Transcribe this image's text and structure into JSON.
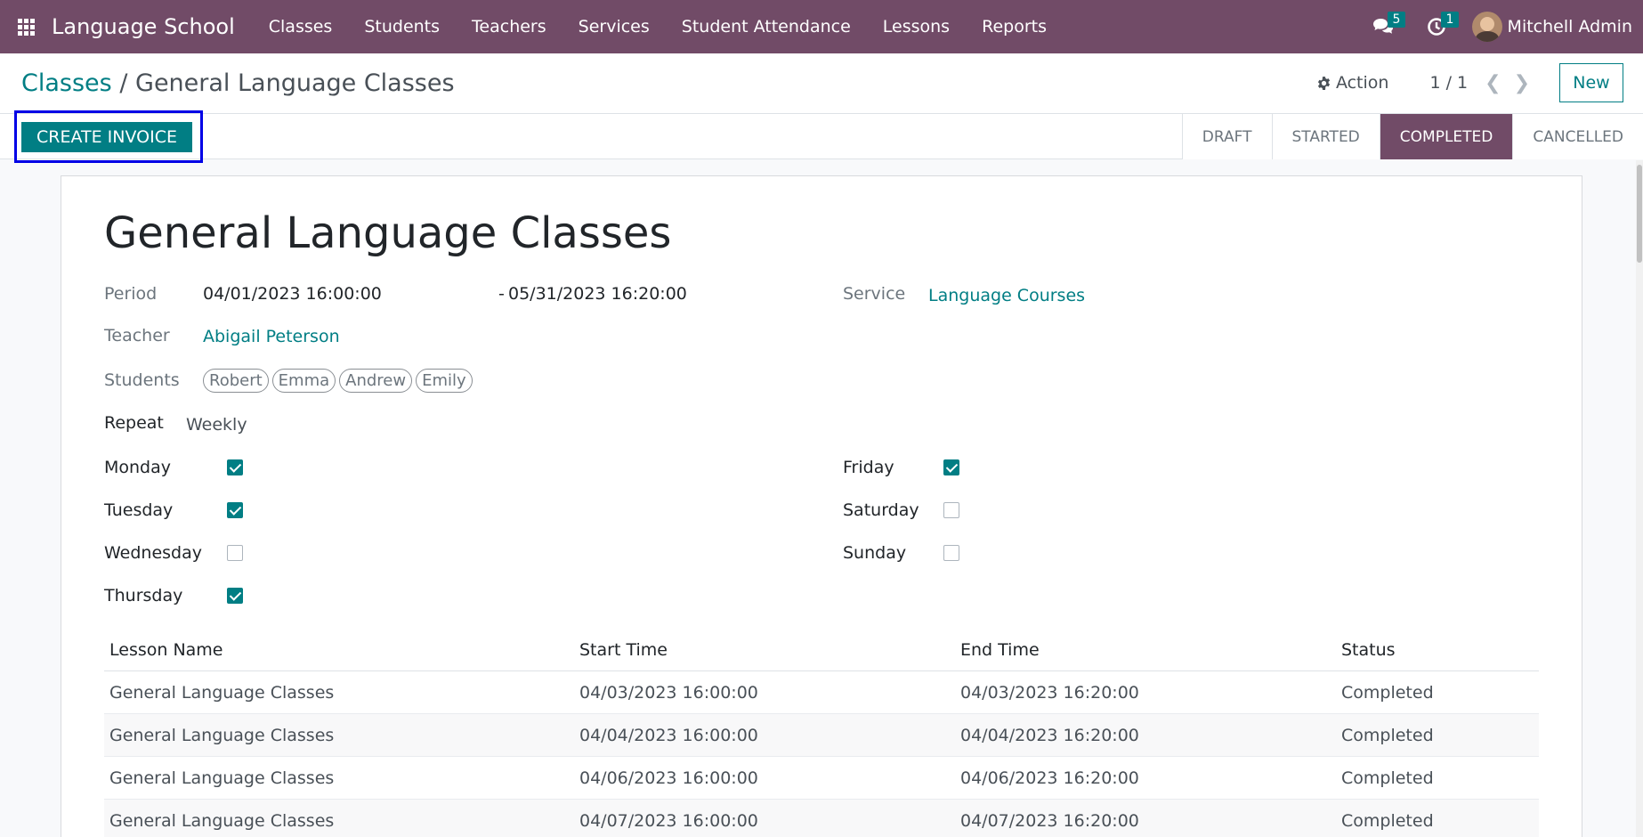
{
  "navbar": {
    "brand": "Language School",
    "menu": [
      "Classes",
      "Students",
      "Teachers",
      "Services",
      "Student Attendance",
      "Lessons",
      "Reports"
    ],
    "messages_count": "5",
    "activities_count": "1",
    "user_name": "Mitchell Admin"
  },
  "control_panel": {
    "breadcrumb_parent": "Classes",
    "breadcrumb_sep": "/",
    "breadcrumb_current": "General Language Classes",
    "action_label": "Action",
    "pager": "1 / 1",
    "new_label": "New"
  },
  "statusbar": {
    "create_invoice_label": "CREATE INVOICE",
    "stages": [
      "DRAFT",
      "STARTED",
      "COMPLETED",
      "CANCELLED"
    ],
    "active_stage": "COMPLETED"
  },
  "form": {
    "title": "General Language Classes",
    "period_label": "Period",
    "period_start": "04/01/2023 16:00:00",
    "period_end": "05/31/2023 16:20:00",
    "period_dash": "-",
    "service_label": "Service",
    "service_value": "Language Courses",
    "teacher_label": "Teacher",
    "teacher_value": "Abigail Peterson",
    "students_label": "Students",
    "students": [
      "Robert",
      "Emma",
      "Andrew",
      "Emily"
    ],
    "repeat_label": "Repeat",
    "repeat_value": "Weekly",
    "days": {
      "monday": {
        "label": "Monday",
        "checked": true
      },
      "tuesday": {
        "label": "Tuesday",
        "checked": true
      },
      "wednesday": {
        "label": "Wednesday",
        "checked": false
      },
      "thursday": {
        "label": "Thursday",
        "checked": true
      },
      "friday": {
        "label": "Friday",
        "checked": true
      },
      "saturday": {
        "label": "Saturday",
        "checked": false
      },
      "sunday": {
        "label": "Sunday",
        "checked": false
      }
    }
  },
  "lessons": {
    "columns": [
      "Lesson Name",
      "Start Time",
      "End Time",
      "Status"
    ],
    "rows": [
      [
        "General Language Classes",
        "04/03/2023 16:00:00",
        "04/03/2023 16:20:00",
        "Completed"
      ],
      [
        "General Language Classes",
        "04/04/2023 16:00:00",
        "04/04/2023 16:20:00",
        "Completed"
      ],
      [
        "General Language Classes",
        "04/06/2023 16:00:00",
        "04/06/2023 16:20:00",
        "Completed"
      ],
      [
        "General Language Classes",
        "04/07/2023 16:00:00",
        "04/07/2023 16:20:00",
        "Completed"
      ]
    ]
  },
  "colors": {
    "brand": "#714b67",
    "accent": "#017e84",
    "highlight": "#0000e6"
  }
}
